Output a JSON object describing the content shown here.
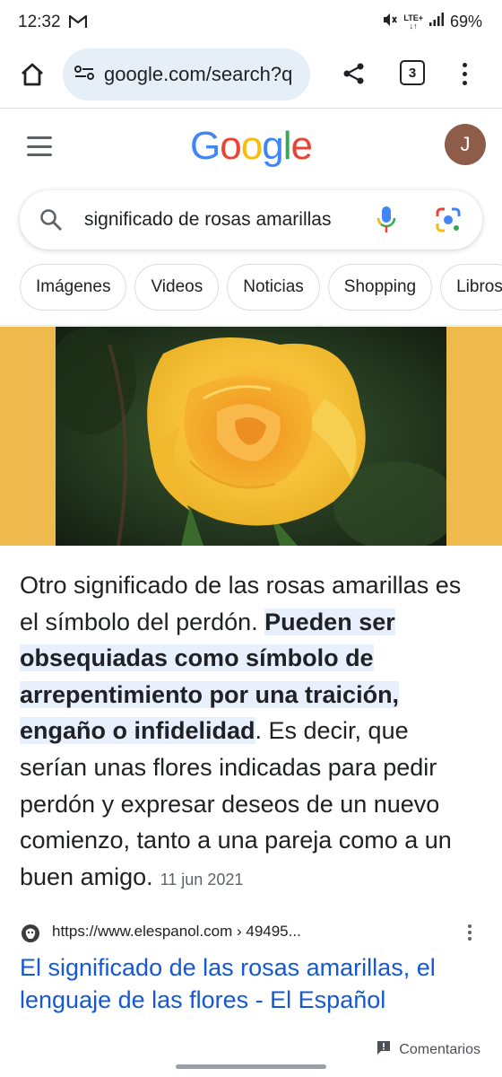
{
  "status_bar": {
    "time": "12:32",
    "battery": "69%",
    "network": "LTE+"
  },
  "browser": {
    "url": "google.com/search?q",
    "tab_count": "3"
  },
  "google": {
    "logo": "Google",
    "avatar_initial": "J",
    "search_query": "significado de rosas amarillas"
  },
  "chips": [
    "Imágenes",
    "Videos",
    "Noticias",
    "Shopping",
    "Libros"
  ],
  "snippet": {
    "text_before": "Otro significado de las rosas amarillas es el símbolo del perdón. ",
    "highlighted": "Pueden ser obsequiadas como símbolo de arrepentimiento por una traición, engaño o infidelidad",
    "text_after": ". Es decir, que serían unas flores indicadas para pedir perdón y expresar deseos de un nuevo comienzo, tanto a una pareja como a un buen amigo.",
    "date": "11 jun 2021"
  },
  "result": {
    "source_url": "https://www.elespanol.com › 49495...",
    "title": "El significado de las rosas amarillas, el lenguaje de las flores - El Español"
  },
  "feedback": {
    "label": "Comentarios"
  },
  "colors": {
    "accent_blue": "#1558d6",
    "highlight": "#e8f0fe",
    "image_band": "#f0b94d",
    "avatar": "#8d5d4a"
  }
}
